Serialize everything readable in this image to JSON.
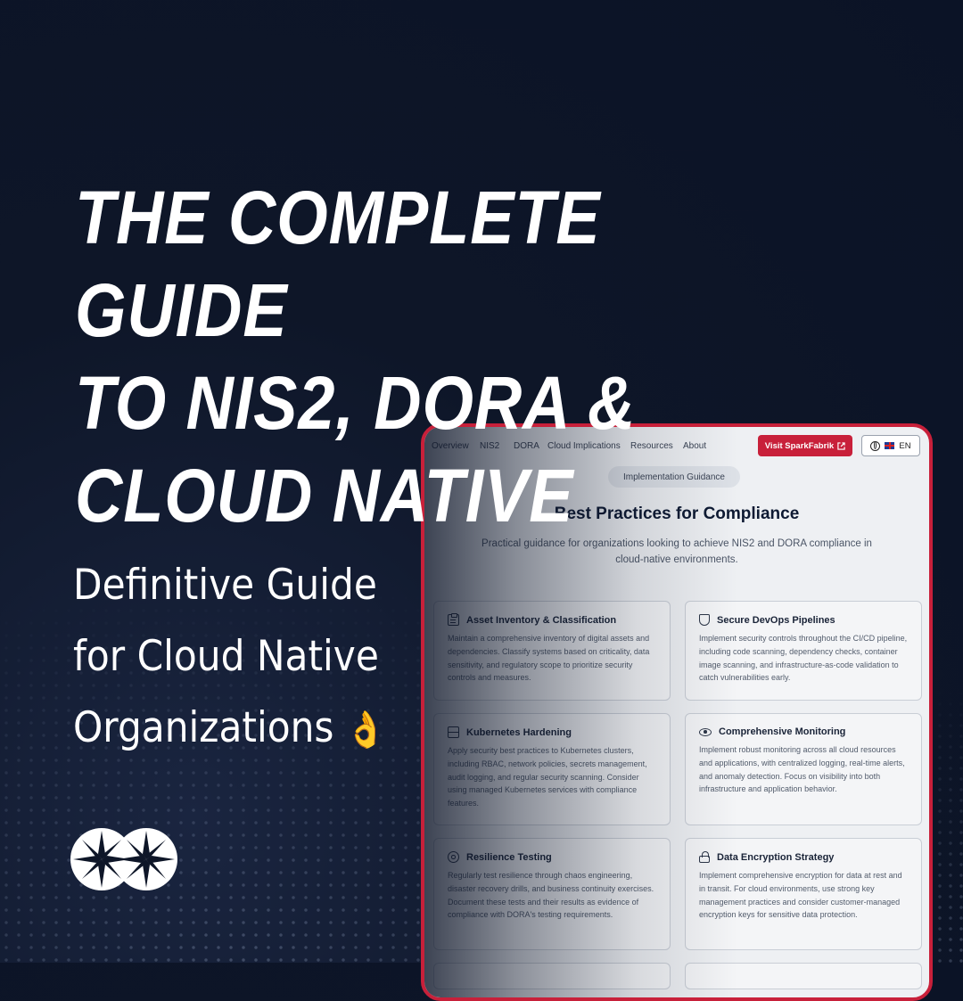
{
  "hero": {
    "headline_lines": [
      "THE COMPLETE GUIDE",
      "TO NIS2, DORA &",
      "CLOUD NATIVE"
    ],
    "subtitle_lines": [
      "Definitive Guide",
      "for Cloud Native",
      "Organizations"
    ],
    "subtitle_emoji_icon": "ok-hand-icon"
  },
  "colors": {
    "background": "#0b1326",
    "accent_red": "#c8203a",
    "text_white": "#ffffff"
  },
  "website": {
    "nav": {
      "items": [
        "Overview",
        "NIS2",
        "DORA",
        "Cloud Implications",
        "Resources",
        "About"
      ],
      "visit_button_label": "Visit SparkFabrik",
      "visit_button_icon": "external-link-icon",
      "language_icon": "globe-icon",
      "language_flag_icon": "uk-flag-icon",
      "language_label": "EN"
    },
    "section_pill": "Implementation Guidance",
    "section_title": "Best Practices for Compliance",
    "section_subtitle": "Practical guidance for organizations looking to achieve NIS2 and DORA compliance in cloud-native environments.",
    "cards": [
      {
        "icon": "clipboard-icon",
        "title": "Asset Inventory & Classification",
        "description": "Maintain a comprehensive inventory of digital assets and dependencies. Classify systems based on criticality, data sensitivity, and regulatory scope to prioritize security controls and measures."
      },
      {
        "icon": "shield-icon",
        "title": "Secure DevOps Pipelines",
        "description": "Implement security controls throughout the CI/CD pipeline, including code scanning, dependency checks, container image scanning, and infrastructure-as-code validation to catch vulnerabilities early."
      },
      {
        "icon": "server-icon",
        "title": "Kubernetes Hardening",
        "description": "Apply security best practices to Kubernetes clusters, including RBAC, network policies, secrets management, audit logging, and regular security scanning. Consider using managed Kubernetes services with compliance features."
      },
      {
        "icon": "eye-icon",
        "title": "Comprehensive Monitoring",
        "description": "Implement robust monitoring across all cloud resources and applications, with centralized logging, real-time alerts, and anomaly detection. Focus on visibility into both infrastructure and application behavior."
      },
      {
        "icon": "lifebuoy-icon",
        "title": "Resilience Testing",
        "description": "Regularly test resilience through chaos engineering, disaster recovery drills, and business continuity exercises. Document these tests and their results as evidence of compliance with DORA's testing requirements."
      },
      {
        "icon": "lock-icon",
        "title": "Data Encryption Strategy",
        "description": "Implement comprehensive encryption for data at rest and in transit. For cloud environments, use strong key management practices and consider customer-managed encryption keys for sensitive data protection."
      }
    ]
  },
  "logo": {
    "icon": "sparkfabrik-logo-icon"
  }
}
